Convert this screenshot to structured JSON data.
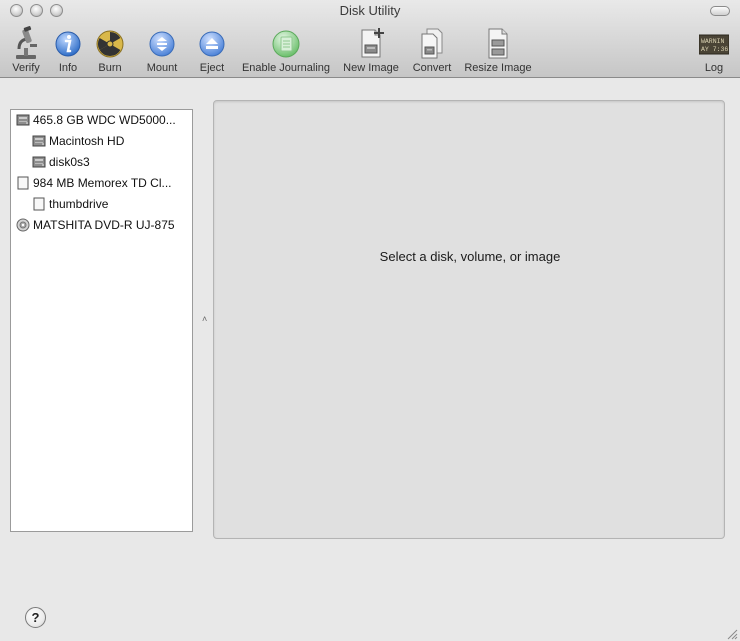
{
  "window": {
    "title": "Disk Utility"
  },
  "toolbar": {
    "items": [
      {
        "id": "verify",
        "label": "Verify",
        "icon": "microscope-icon"
      },
      {
        "id": "info",
        "label": "Info",
        "icon": "info-icon"
      },
      {
        "id": "burn",
        "label": "Burn",
        "icon": "radiation-icon"
      },
      {
        "id": "mount",
        "label": "Mount",
        "icon": "mount-icon"
      },
      {
        "id": "eject",
        "label": "Eject",
        "icon": "eject-icon"
      },
      {
        "id": "journaling",
        "label": "Enable Journaling",
        "icon": "journal-icon"
      },
      {
        "id": "new_image",
        "label": "New Image",
        "icon": "new-image-icon"
      },
      {
        "id": "convert",
        "label": "Convert",
        "icon": "convert-icon"
      },
      {
        "id": "resize_image",
        "label": "Resize Image",
        "icon": "resize-image-icon"
      },
      {
        "id": "log",
        "label": "Log",
        "icon": "log-icon"
      }
    ],
    "log_icon_text": [
      "WARNIN",
      "AY 7:36"
    ]
  },
  "sidebar": {
    "items": [
      {
        "label": "465.8 GB WDC WD5000...",
        "level": 0,
        "icon": "hard-drive-icon"
      },
      {
        "label": "Macintosh HD",
        "level": 1,
        "icon": "hard-drive-icon"
      },
      {
        "label": "disk0s3",
        "level": 1,
        "icon": "hard-drive-icon"
      },
      {
        "label": "984 MB Memorex TD Cl...",
        "level": 0,
        "icon": "usb-drive-icon"
      },
      {
        "label": "thumbdrive",
        "level": 1,
        "icon": "usb-drive-icon"
      },
      {
        "label": "MATSHITA DVD-R UJ-875",
        "level": 0,
        "icon": "optical-drive-icon"
      }
    ]
  },
  "detail": {
    "placeholder": "Select a disk, volume, or image"
  },
  "help": {
    "label": "?"
  },
  "colors": {
    "info_blue": "#4a83d4",
    "mount_blue": "#5b8fe0",
    "journal_green": "#7cc87c"
  }
}
